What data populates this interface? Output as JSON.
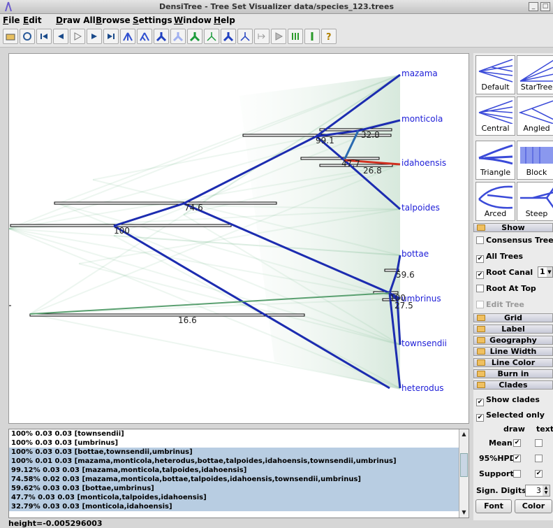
{
  "window": {
    "title": "DensiTree - Tree Set Visualizer data/species_123.trees"
  },
  "menu": [
    "File",
    "Edit",
    "Draw All",
    "Browse",
    "Settings",
    "Window",
    "Help"
  ],
  "toolbar": [
    "open-icon",
    "reload-icon",
    "first-tree-icon",
    "previous-tree-icon",
    "play-icon",
    "next-tree-icon",
    "last-tree-icon",
    "tree-style-1-icon",
    "tree-style-2-icon",
    "tree-style-3-icon",
    "tree-style-4-icon",
    "tree-style-5-icon",
    "tree-style-6-icon",
    "tree-style-7-icon",
    "tree-style-8-icon",
    "collapse-icon",
    "animate-icon",
    "burnin-icon",
    "grid-icon",
    "help-icon"
  ],
  "taxa": [
    "mazama",
    "monticola",
    "idahoensis",
    "talpoides",
    "bottae",
    "umbrinus",
    "townsendii",
    "heterodus"
  ],
  "support_labels": [
    "100",
    "74.6",
    "99.1",
    "32.8",
    "47.7",
    "26.8",
    "59.6",
    "100",
    "27.5",
    "16.6"
  ],
  "clades": [
    {
      "text": "100% 0.03 0.03 [townsendii]",
      "selected": false
    },
    {
      "text": "100% 0.03 0.03 [umbrinus]",
      "selected": false
    },
    {
      "text": "100% 0.03 0.03 [bottae,townsendii,umbrinus]",
      "selected": true
    },
    {
      "text": "100% 0.01 0.03 [mazama,monticola,heterodus,bottae,talpoides,idahoensis,townsendii,umbrinus]",
      "selected": true
    },
    {
      "text": "99.12% 0.03 0.03 [mazama,monticola,talpoides,idahoensis]",
      "selected": true
    },
    {
      "text": "74.58% 0.02 0.03 [mazama,monticola,bottae,talpoides,idahoensis,townsendii,umbrinus]",
      "selected": true
    },
    {
      "text": "59.62% 0.03 0.03 [bottae,umbrinus]",
      "selected": true
    },
    {
      "text": "47.7% 0.03 0.03 [monticola,talpoides,idahoensis]",
      "selected": true
    },
    {
      "text": "32.79% 0.03 0.03 [monticola,idahoensis]",
      "selected": true
    }
  ],
  "status": "height=-0.005296003",
  "layouts": [
    "Default",
    "StarTree",
    "Central",
    "Angled",
    "Triangle",
    "Block",
    "Arced",
    "Steep"
  ],
  "panel": {
    "show": "Show",
    "consensus": "Consensus Trees",
    "all_trees": "All Trees",
    "root_canal": "Root Canal",
    "root_canal_value": "1",
    "root_at_top": "Root At Top",
    "edit_tree": "Edit Tree",
    "sections": [
      "Grid",
      "Label",
      "Geography",
      "Line Width",
      "Line Color",
      "Burn in",
      "Clades"
    ],
    "show_clades": "Show clades",
    "selected_only": "Selected only",
    "col_draw": "draw",
    "col_text": "text",
    "mean": "Mean",
    "hpd": "95%HPD",
    "support": "Support",
    "sign_digits": "Sign. Digits",
    "sign_digits_value": "3",
    "font": "Font",
    "color": "Color"
  },
  "colors": {
    "accent": "#2020d8",
    "tree_green": "#1a8a3a",
    "tree_blue": "#1c2cb0",
    "tree_red": "#d03020",
    "selection": "#b8cde2"
  }
}
